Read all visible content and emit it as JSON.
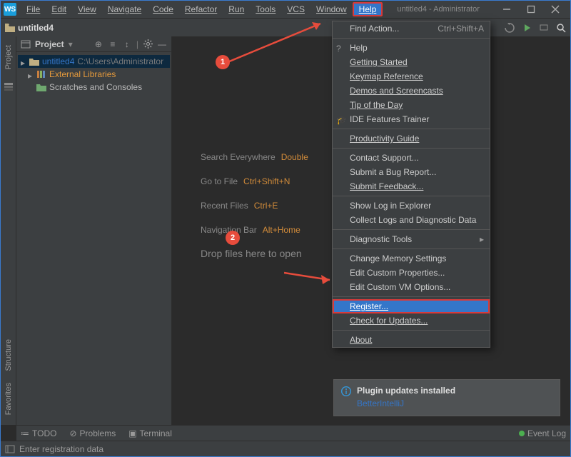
{
  "app_name_short": "WS",
  "menubar": {
    "items": [
      "File",
      "Edit",
      "View",
      "Navigate",
      "Code",
      "Refactor",
      "Run",
      "Tools",
      "VCS",
      "Window",
      "Help"
    ]
  },
  "title": "untitled4 - Administrator",
  "breadcrumb": {
    "name": "untitled4"
  },
  "project_panel": {
    "title": "Project",
    "tree": {
      "root_name": "untitled4",
      "root_path": "C:\\Users\\Administrator",
      "lib_label": "External Libraries",
      "scratch_label": "Scratches and Consoles"
    }
  },
  "welcome": {
    "search_label": "Search Everywhere",
    "search_sc": "Double",
    "goto_label": "Go to File",
    "goto_sc": "Ctrl+Shift+N",
    "recent_label": "Recent Files",
    "recent_sc": "Ctrl+E",
    "nav_label": "Navigation Bar",
    "nav_sc": "Alt+Home",
    "drop_label": "Drop files here to open"
  },
  "help_menu": {
    "find_action": "Find Action...",
    "find_action_sc": "Ctrl+Shift+A",
    "help": "Help",
    "getting_started": "Getting Started",
    "keymap_ref": "Keymap Reference",
    "demos": "Demos and Screencasts",
    "tip": "Tip of the Day",
    "trainer": "IDE Features Trainer",
    "productivity": "Productivity Guide",
    "contact": "Contact Support...",
    "bug": "Submit a Bug Report...",
    "feedback": "Submit Feedback...",
    "showlog": "Show Log in Explorer",
    "collect": "Collect Logs and Diagnostic Data",
    "diag": "Diagnostic Tools",
    "memory": "Change Memory Settings",
    "custom_props": "Edit Custom Properties...",
    "custom_vm": "Edit Custom VM Options...",
    "register": "Register...",
    "check_updates": "Check for Updates...",
    "about": "About"
  },
  "left_sidebar": {
    "project": "Project",
    "structure": "Structure",
    "favorites": "Favorites"
  },
  "notification": {
    "title": "Plugin updates installed",
    "link": "BetterIntelliJ"
  },
  "bottom": {
    "todo": "TODO",
    "problems": "Problems",
    "terminal": "Terminal",
    "eventlog": "Event Log"
  },
  "status": {
    "text": "Enter registration data"
  },
  "annotations": {
    "badge1": "1",
    "badge2": "2"
  }
}
